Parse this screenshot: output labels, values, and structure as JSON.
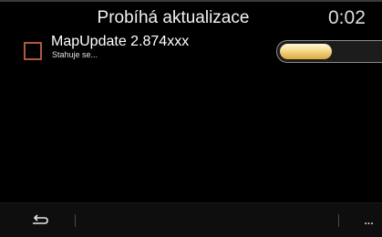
{
  "header": {
    "title": "Probíhá aktualizace",
    "timer": "0:02"
  },
  "update_item": {
    "name": "MapUpdate 2.874xxx",
    "status": "Stahuje se...",
    "progress": 0.52
  },
  "footer": {
    "back_icon": "back-arrow-icon",
    "more_label": "..."
  },
  "colors": {
    "background": "#000000",
    "checkbox_border": "#b2563f",
    "progress_fill": "#f4d98a"
  }
}
